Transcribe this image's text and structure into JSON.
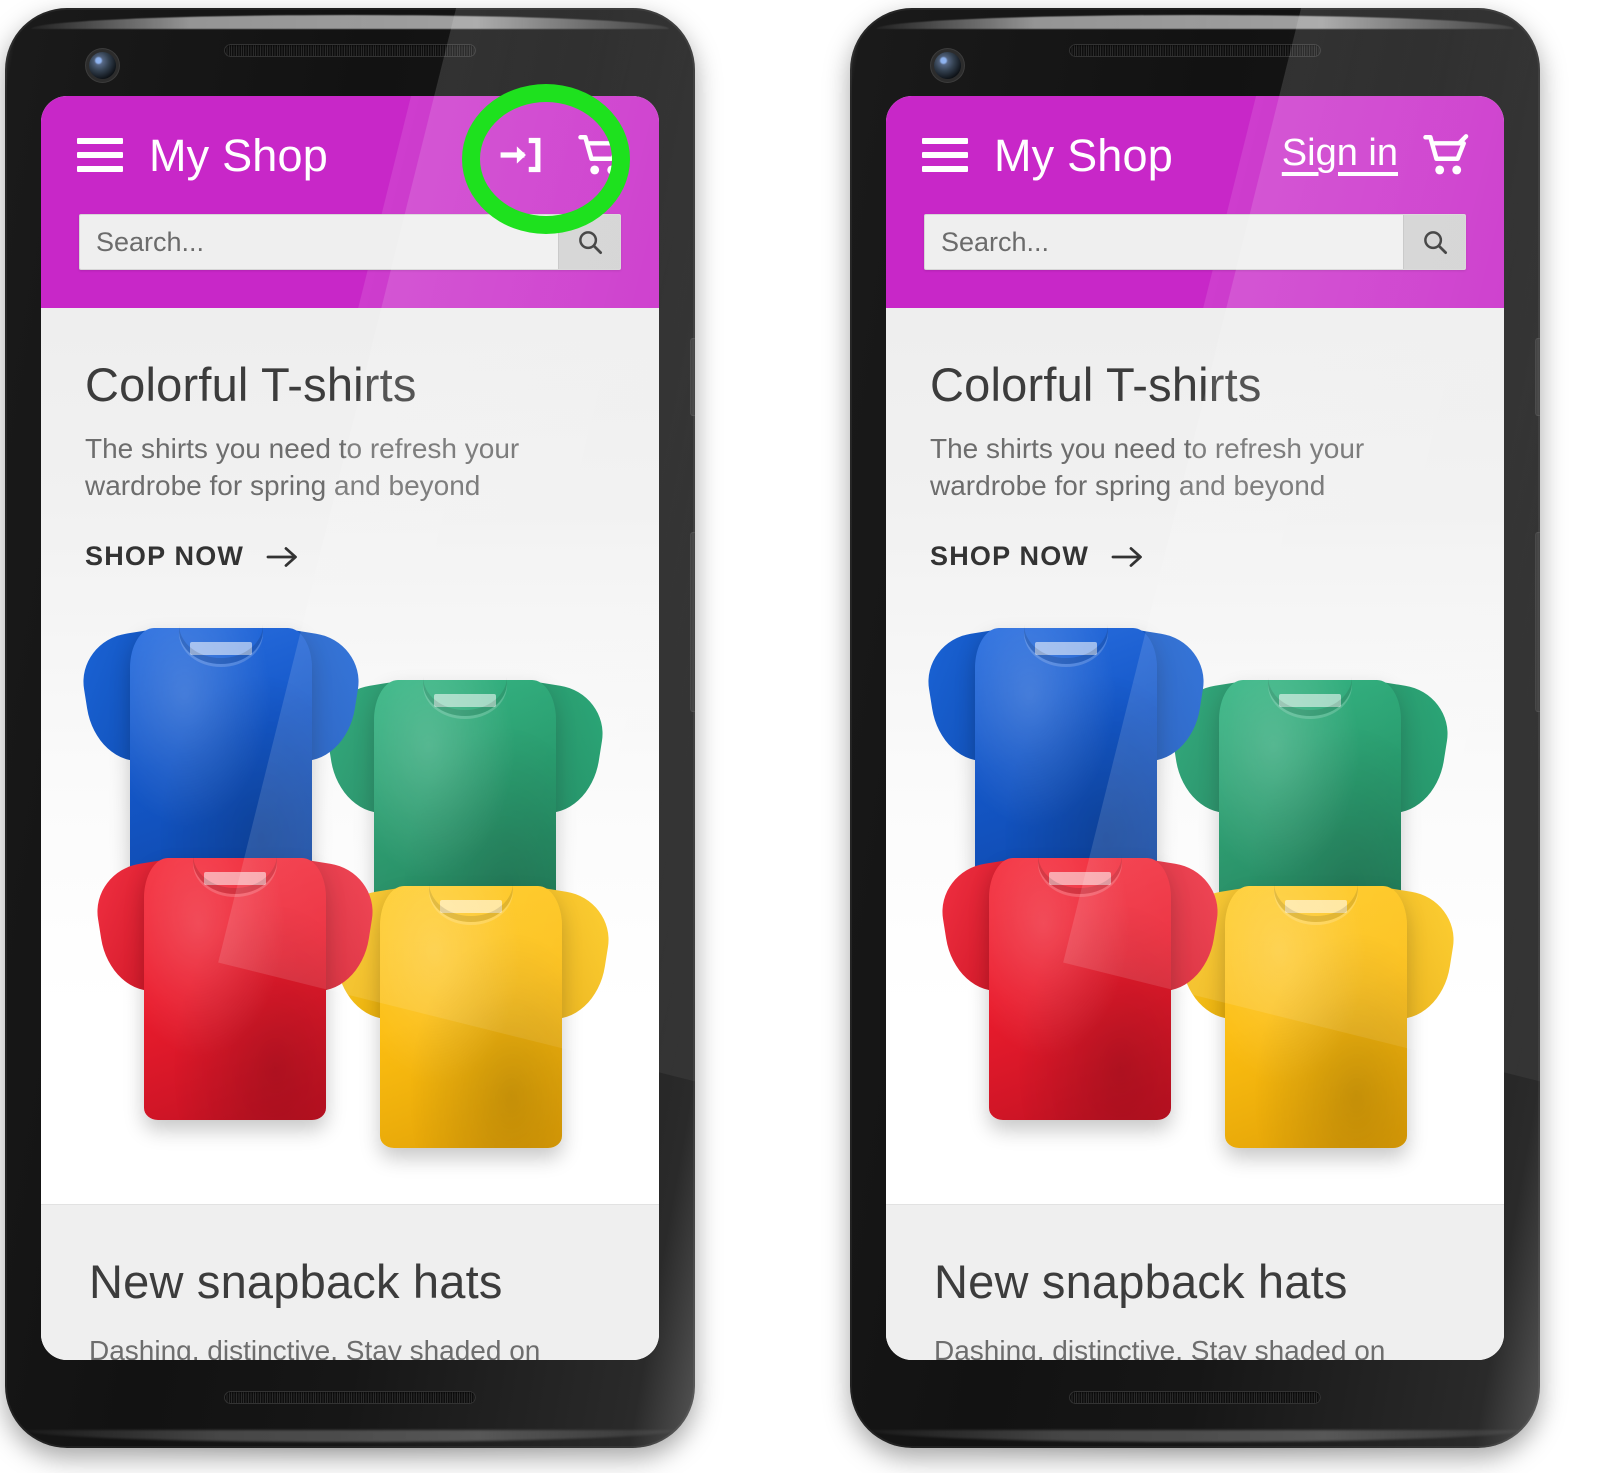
{
  "app": {
    "title": "My Shop",
    "brand_color": "#c827c8",
    "annotation_color": "#1ee11e"
  },
  "header": {
    "menu_icon": "hamburger-menu-icon",
    "cart_icon": "shopping-cart-icon",
    "login_icon": "login-arrow-icon",
    "signin_label": "Sign in"
  },
  "search": {
    "value": "",
    "placeholder": "Search...",
    "button_icon": "search-icon"
  },
  "cards": [
    {
      "title": "Colorful T-shirts",
      "subtitle": "The shirts you need to refresh your wardrobe for spring and beyond",
      "cta": "SHOP NOW",
      "cta_icon": "arrow-right-icon",
      "image_alt": "four folded t-shirts",
      "shirt_colors": [
        "#1457c8",
        "#13915f",
        "#ea1c2d",
        "#fcbe11"
      ]
    },
    {
      "title": "New snapback hats",
      "subtitle": "Dashing, distinctive. Stay shaded on sunny",
      "cta": "",
      "cta_icon": ""
    }
  ],
  "phones": [
    {
      "id": "phone-left",
      "variant": "icon",
      "highlight_target": "login-icon-button"
    },
    {
      "id": "phone-right",
      "variant": "text",
      "highlight_target": "sign-in-link"
    }
  ]
}
